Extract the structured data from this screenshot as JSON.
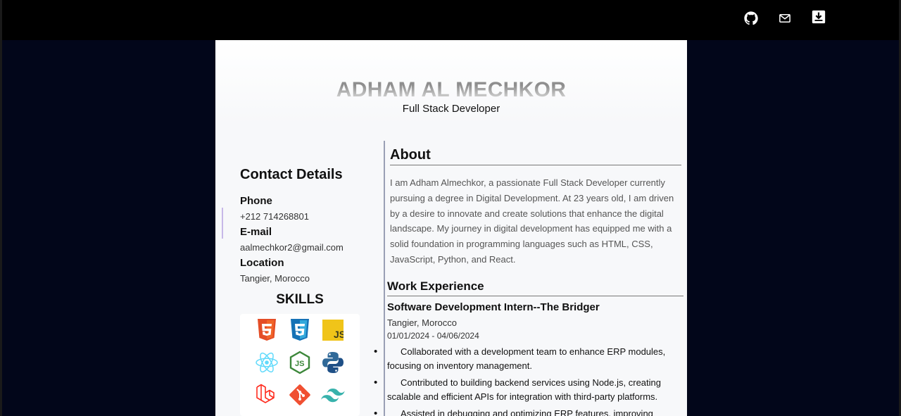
{
  "nav": {
    "icons": [
      "github-icon",
      "mail-icon",
      "download-icon"
    ]
  },
  "header": {
    "name": "ADHAM AL MECHKOR",
    "role": "Full Stack Developer"
  },
  "contact": {
    "title": "Contact Details",
    "phone_label": "Phone",
    "phone": "+212 714268801",
    "email_label": "E-mail",
    "email": "aalmechkor2@gmail.com",
    "location_label": "Location",
    "location": "Tangier, Morocco"
  },
  "skills": {
    "title": "SKILLS",
    "items": [
      {
        "name": "html5-icon",
        "color": "#e44d26"
      },
      {
        "name": "css3-icon",
        "color": "#2965f1"
      },
      {
        "name": "javascript-icon",
        "color": "#f0c419"
      },
      {
        "name": "react-icon",
        "color": "#61dafb"
      },
      {
        "name": "nodejs-icon",
        "color": "#3c873a"
      },
      {
        "name": "python-icon",
        "color": "#306998"
      },
      {
        "name": "laravel-icon",
        "color": "#ff2d20"
      },
      {
        "name": "git-icon",
        "color": "#f05032"
      },
      {
        "name": "tailwind-icon",
        "color": "#38b2ac"
      }
    ]
  },
  "about": {
    "title": "About",
    "text": "I am Adham Almechkor, a passionate Full Stack Developer currently pursuing a degree in Digital Development. At 23 years old, I am driven by a desire to innovate and create solutions that enhance the digital landscape. My journey in digital development has equipped me with a solid foundation in programming languages such as HTML, CSS, JavaScript, Python, and React."
  },
  "work": {
    "title": "Work Experience",
    "job_title": "Software Development Intern--The Bridger",
    "job_location": "Tangier, Morocco",
    "job_dates": "01/01/2024 - 04/06/2024",
    "bullets": [
      "Collaborated with a development team to enhance ERP modules, focusing on inventory management.",
      "Contributed to building backend services using Node.js, creating scalable and efficient APIs for integration with third-party platforms.",
      "Assisted in debugging and optimizing ERP features, improving"
    ]
  },
  "colors": {
    "page_background": "#02061a",
    "topbar": "#000000",
    "paper": "#f7f8fa"
  }
}
